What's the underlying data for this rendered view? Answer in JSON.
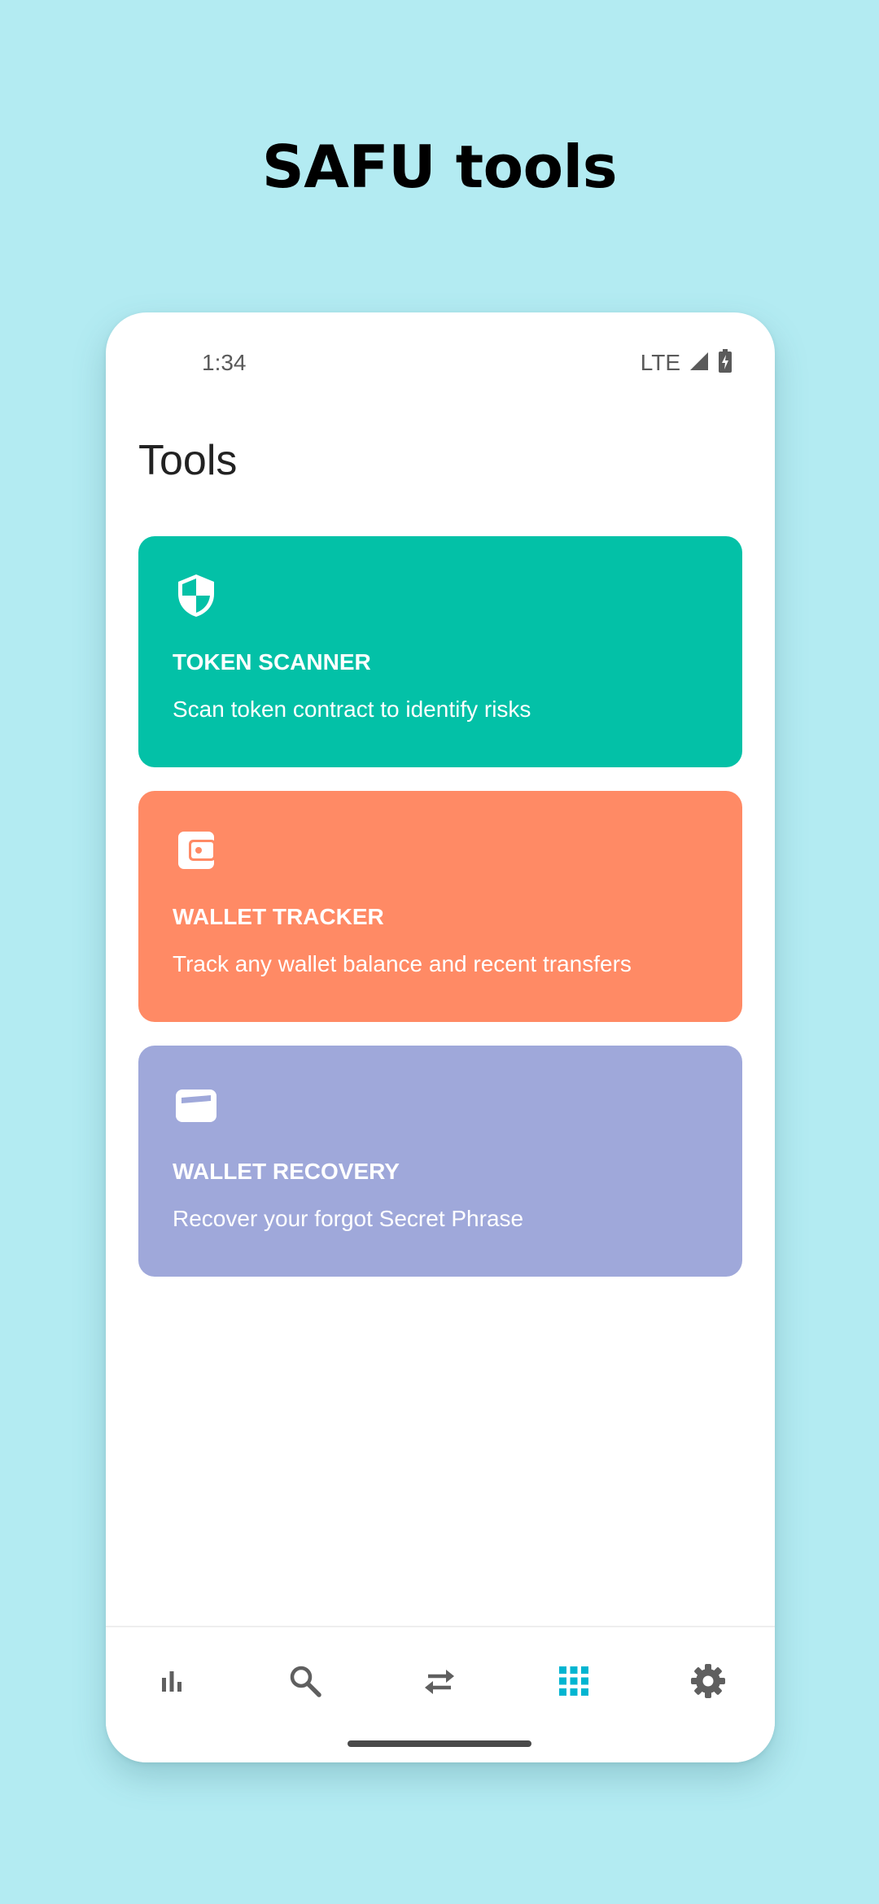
{
  "headline": "SAFU tools",
  "status_bar": {
    "time": "1:34",
    "network": "LTE",
    "icons": [
      "signal-icon",
      "battery-charging-icon"
    ]
  },
  "page": {
    "title": "Tools"
  },
  "tools": [
    {
      "title": "TOKEN SCANNER",
      "description": "Scan token contract to identify risks",
      "icon": "shield-icon",
      "color": "#03c1a7"
    },
    {
      "title": "WALLET TRACKER",
      "description": "Track any wallet balance and recent transfers",
      "icon": "wallet-icon",
      "color": "#ff8a65"
    },
    {
      "title": "WALLET RECOVERY",
      "description": "Recover your forgot Secret Phrase",
      "icon": "card-icon",
      "color": "#9fa8da"
    }
  ],
  "bottom_nav": {
    "items": [
      {
        "icon": "bar-chart-icon",
        "active": false
      },
      {
        "icon": "search-icon",
        "active": false
      },
      {
        "icon": "swap-arrows-icon",
        "active": false
      },
      {
        "icon": "grid-apps-icon",
        "active": true
      },
      {
        "icon": "settings-gear-icon",
        "active": false
      }
    ],
    "active_color": "#00b5d1",
    "inactive_color": "#5f5f5f"
  },
  "colors": {
    "background": "#b3ebf2",
    "phone_background": "#ffffff"
  }
}
